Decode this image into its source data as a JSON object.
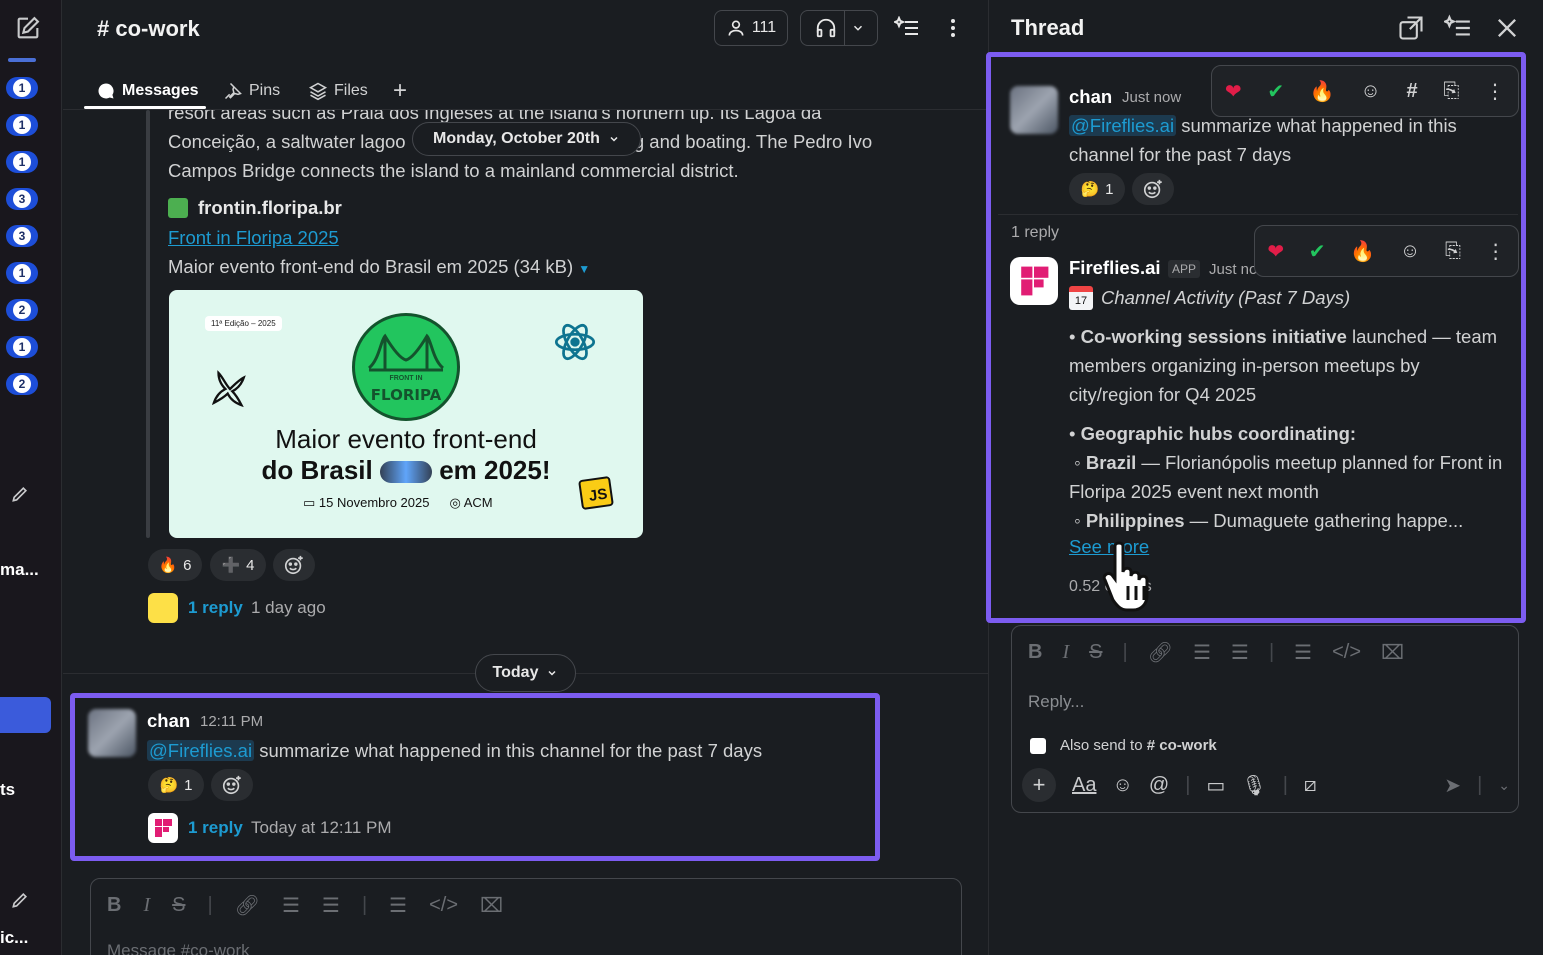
{
  "rail": {
    "badges": [
      "1",
      "1",
      "1",
      "3",
      "3",
      "1",
      "2",
      "1",
      "2"
    ],
    "text_ma": "ma...",
    "text_ts": "ts",
    "text_ic": "ic..."
  },
  "channel": {
    "title": "# co-work",
    "member_count": "111",
    "tabs": {
      "messages": "Messages",
      "pins": "Pins",
      "files": "Files"
    }
  },
  "message1": {
    "text_line1": "resort areas such as Praia dos Ingleses at the island's northern tip. Its Lagoa da",
    "text_line2_a": "Conceição, a saltwater lagoo",
    "text_line2_b": "ng and boating. The Pedro Ivo",
    "text_line3": "Campos Bridge connects the island to a mainland commercial district.",
    "date_pill": "Monday, October 20th",
    "link_site": "frontin.floripa.br",
    "link_title": "Front in Floripa 2025",
    "link_desc": "Maior evento front-end do Brasil em 2025 (34 kB)",
    "preview": {
      "edicao": "11ª Edição – 2025",
      "front_in": "FRONT IN",
      "floripa": "FLORIPA",
      "line1": "Maior evento front-end",
      "line2_a": "do Brasil",
      "line2_b": "em 2025!",
      "date": "15 Novembro 2025",
      "place": "ACM",
      "js": "JS"
    },
    "reactions": [
      {
        "emoji": "🔥",
        "count": "6"
      },
      {
        "emoji": "➕",
        "count": "4"
      }
    ],
    "reply_link": "1 reply",
    "reply_time": "1 day ago"
  },
  "today_pill": "Today",
  "message2": {
    "author": "chan",
    "time": "12:11 PM",
    "mention": "@Fireflies.ai",
    "text": " summarize what happened in this channel for the past 7 days",
    "reaction": {
      "emoji": "🤔",
      "count": "1"
    },
    "reply_link": "1 reply",
    "reply_time": "Today at 12:11 PM"
  },
  "composer": {
    "placeholder": "Message #co-work"
  },
  "thread": {
    "title": "Thread",
    "root": {
      "author": "chan",
      "time": "Just now",
      "mention": "@Fireflies.ai",
      "text": " summarize what happened in this channel for the past 7 days",
      "reaction": {
        "emoji": "🤔",
        "count": "1"
      }
    },
    "reply_count": "1 reply",
    "bot": {
      "name": "Fireflies.ai",
      "badge": "APP",
      "time": "Just no",
      "heading": "Channel Activity (Past 7 Days)",
      "b1_bold": "Co-working sessions initiative",
      "b1_rest": " launched — team members organizing in-person meetups by city/region for Q4 2025",
      "b2_bold": "Geographic hubs coordinating:",
      "s1_bold": "Brazil",
      "s1_rest": " — Florianópolis meetup planned for Front in Floripa 2025 event next month",
      "s2_bold": "Philippines",
      "s2_rest": " — Dumaguete gathering happe...",
      "see_more": "See more",
      "credits": "0.52 credits"
    },
    "composer": {
      "placeholder": "Reply...",
      "also_send": "Also send to",
      "also_channel": "# co-work",
      "aa": "Aa"
    }
  },
  "colors": {
    "accent": "#7c5cf0",
    "link": "#1d9bd1",
    "badge": "#1d4ed8"
  }
}
